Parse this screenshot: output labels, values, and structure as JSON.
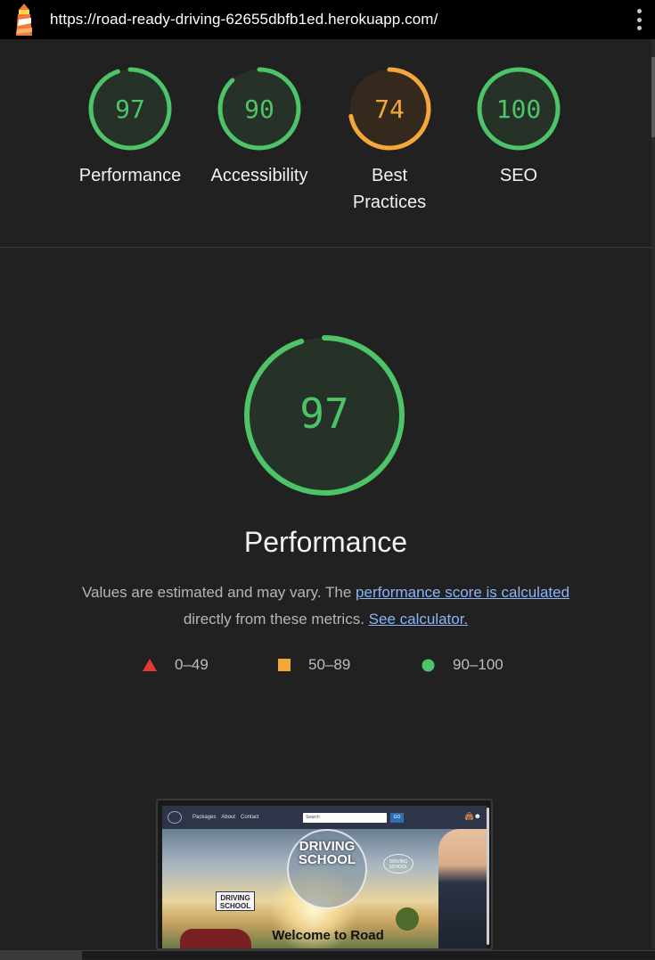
{
  "address_bar": {
    "url": "https://road-ready-driving-62655dbfb1ed.herokuapp.com/"
  },
  "summary_gauges": [
    {
      "label": "Performance",
      "score": 97,
      "color": "#4cc467"
    },
    {
      "label": "Accessibility",
      "score": 90,
      "color": "#4cc467"
    },
    {
      "label": "Best Practices",
      "score": 74,
      "color": "#f4a83a"
    },
    {
      "label": "SEO",
      "score": 100,
      "color": "#4cc467"
    }
  ],
  "performance": {
    "score": 97,
    "title": "Performance",
    "desc_prefix": "Values are estimated and may vary. The ",
    "desc_link1": "performance score is calculated",
    "desc_mid": " directly from these metrics. ",
    "desc_link2": "See calculator."
  },
  "legend": [
    {
      "range": "0–49",
      "shape": "triangle",
      "color": "#e53935"
    },
    {
      "range": "50–89",
      "shape": "square",
      "color": "#f4a83a"
    },
    {
      "range": "90–100",
      "shape": "circle",
      "color": "#4cc467"
    }
  ],
  "thumbnail": {
    "nav_links": [
      "Packages",
      "About",
      "Contact"
    ],
    "search_placeholder": "Search",
    "go_label": "GO",
    "hero_title": "DRIVING SCHOOL",
    "sign_text": "DRIVING SCHOOL",
    "badge_text": "DRIVING SCHOOL",
    "welcome_text": "Welcome to Road"
  },
  "colors": {
    "pass": "#4cc467",
    "average": "#f4a83a",
    "fail": "#e53935",
    "link": "#8ab4f8"
  }
}
